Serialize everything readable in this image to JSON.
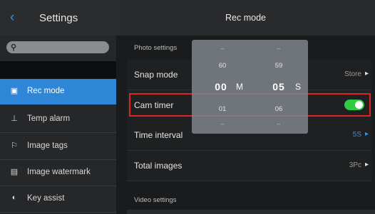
{
  "sidebar": {
    "title": "Settings",
    "back_icon": "chevron-left-icon",
    "search_icon": "search-icon",
    "items": [
      {
        "label": "Rec mode",
        "icon": "camera-icon",
        "glyph": "▣",
        "active": true
      },
      {
        "label": "Temp alarm",
        "icon": "thermometer-icon",
        "glyph": "⊥",
        "active": false
      },
      {
        "label": "Image tags",
        "icon": "flag-icon",
        "glyph": "⚐",
        "active": false
      },
      {
        "label": "Image watermark",
        "icon": "watermark-icon",
        "glyph": "▤",
        "active": false
      },
      {
        "label": "Key assist",
        "icon": "toggle-icon",
        "glyph": "◐",
        "active": false
      }
    ]
  },
  "main": {
    "title": "Rec mode",
    "photo_section": "Photo settings",
    "video_section": "Video settings",
    "rows": {
      "snap_mode": {
        "label": "Snap mode",
        "value": "Store"
      },
      "cam_timer": {
        "label": "Cam timer",
        "enabled": true
      },
      "time_interval": {
        "label": "Time interval",
        "value": "5S"
      },
      "total_images": {
        "label": "Total images",
        "value": "3Pc"
      }
    }
  },
  "picker": {
    "minutes": {
      "above2": "--",
      "above1": "60",
      "selected": "00",
      "below1": "01",
      "below2": "--",
      "unit": "M"
    },
    "seconds": {
      "above2": "--",
      "above1": "59",
      "selected": "05",
      "below1": "06",
      "below2": "--",
      "unit": "S"
    }
  },
  "colors": {
    "accent": "#2f86d6",
    "toggle_on": "#2ecc40",
    "highlight": "#e02222"
  }
}
